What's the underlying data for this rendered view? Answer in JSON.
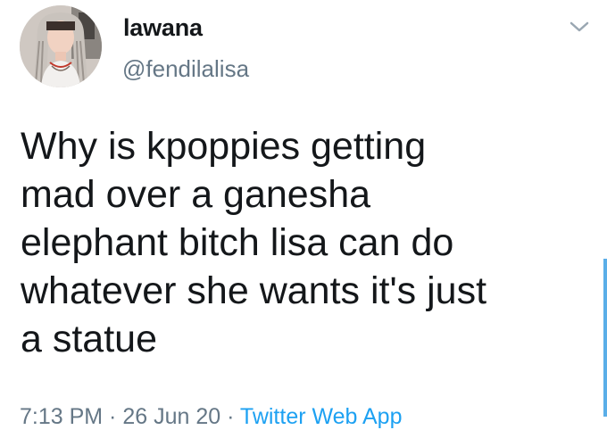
{
  "tweet": {
    "display_name": "lawana",
    "handle": "@fendilalisa",
    "text": "Why is kpoppies getting\nmad over a ganesha\nelephant bitch lisa can do\nwhatever she wants it's just\na statue",
    "timestamp": "7:13 PM · 26 Jun 20",
    "source": "Twitter Web App",
    "menu_icon": "chevron-down-icon",
    "avatar_icon": "profile-photo"
  },
  "colors": {
    "text": "#14171a",
    "secondary": "#657786",
    "link": "#1da1f2",
    "scrollbar": "#5aaee8"
  }
}
